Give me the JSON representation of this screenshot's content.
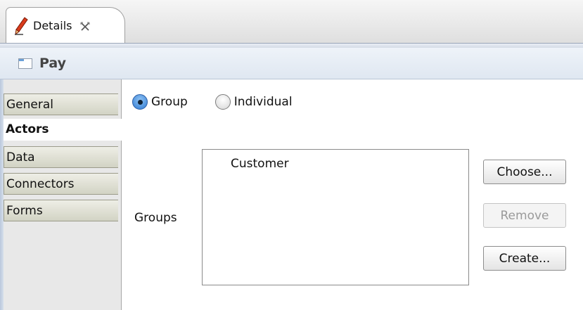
{
  "tab": {
    "label": "Details"
  },
  "title": {
    "text": "Pay"
  },
  "sidebar": {
    "items": [
      {
        "label": "General"
      },
      {
        "label": "Actors"
      },
      {
        "label": "Data"
      },
      {
        "label": "Connectors"
      },
      {
        "label": "Forms"
      }
    ],
    "active": "Actors"
  },
  "actor_type": {
    "options": [
      {
        "label": "Group",
        "selected": true
      },
      {
        "label": "Individual",
        "selected": false
      }
    ]
  },
  "groups": {
    "label": "Groups",
    "items": [
      "Customer"
    ]
  },
  "buttons": {
    "choose": "Choose...",
    "remove": "Remove",
    "create": "Create..."
  },
  "colors": {
    "accent": "#2f7ad1",
    "sidebar_tab": "#d2d3c4",
    "title_bar": "#dfe7f1"
  },
  "icons": {
    "tab": "pencil-icon",
    "tab_close": "close-icon",
    "title": "window-icon"
  }
}
